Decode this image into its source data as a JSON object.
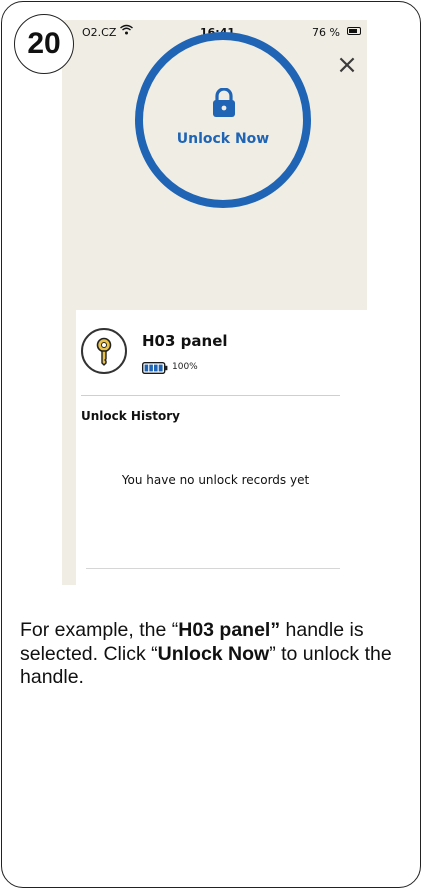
{
  "step_number": "20",
  "status_bar": {
    "carrier": "O2.CZ",
    "wifi_icon": "wifi-icon",
    "time": "16:41",
    "battery_percent": "76 %"
  },
  "close_icon": "×",
  "unlock": {
    "icon": "padlock-icon",
    "label": "Unlock Now"
  },
  "device": {
    "icon": "key-icon",
    "name": "H03 panel",
    "battery_percent": "100%",
    "battery_level": 1.0
  },
  "history": {
    "title": "Unlock History",
    "empty_message": "You have no unlock records yet"
  },
  "caption": {
    "p1": "For example, the “",
    "b1": "H03 panel”",
    "p2": " handle is selected. Click “",
    "b2": "Unlock Now",
    "p3": "” to unlock the handle."
  },
  "colors": {
    "accent": "#1f64b5",
    "phone_bg": "#efede4",
    "card_bg": "#ffffff",
    "key_gold": "#e8c24a"
  }
}
